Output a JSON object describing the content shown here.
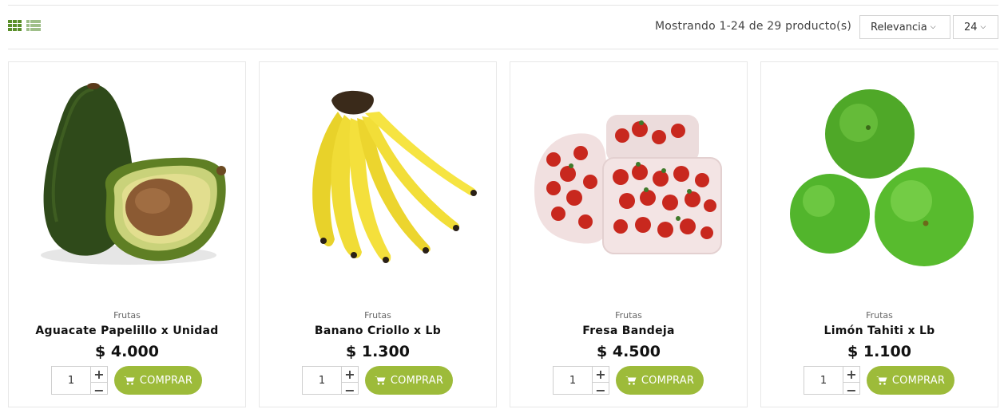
{
  "toolbar": {
    "showing": "Mostrando 1-24 de 29 producto(s)",
    "sort_label": "Relevancia",
    "per_page": "24",
    "grid_view_icon": "grid-icon",
    "list_view_icon": "list-icon"
  },
  "theme": {
    "accent": "#9dbb3a",
    "grid_active": "#5a8f2a",
    "list_inactive": "#9fbf8a"
  },
  "products": [
    {
      "category": "Frutas",
      "name": "Aguacate Papelillo x Unidad",
      "price": "$ 4.000",
      "qty": "1",
      "buy_label": "COMPRAR",
      "image": "avocado"
    },
    {
      "category": "Frutas",
      "name": "Banano Criollo x Lb",
      "price": "$ 1.300",
      "qty": "1",
      "buy_label": "COMPRAR",
      "image": "banana"
    },
    {
      "category": "Frutas",
      "name": "Fresa Bandeja",
      "price": "$ 4.500",
      "qty": "1",
      "buy_label": "COMPRAR",
      "image": "strawberry"
    },
    {
      "category": "Frutas",
      "name": "Limón Tahiti x Lb",
      "price": "$ 1.100",
      "qty": "1",
      "buy_label": "COMPRAR",
      "image": "lime"
    }
  ]
}
